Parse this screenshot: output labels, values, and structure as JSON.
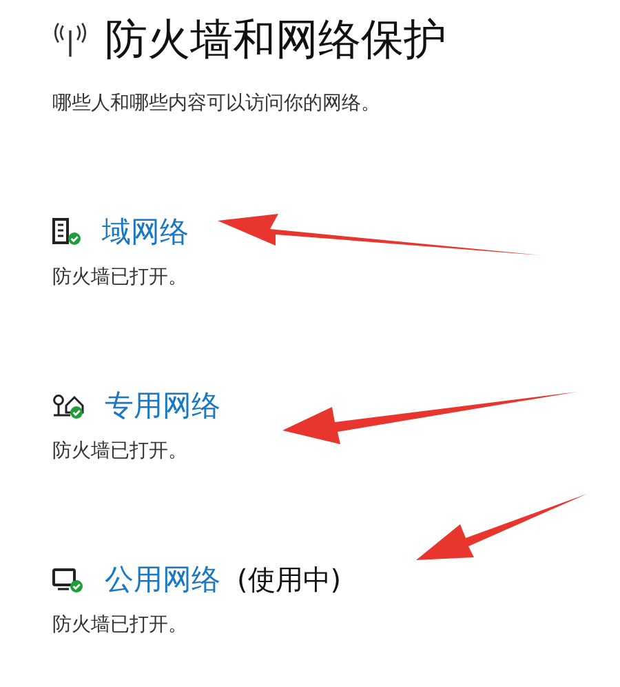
{
  "title": "防火墙和网络保护",
  "subtitle": "哪些人和哪些内容可以访问你的网络。",
  "networks": [
    {
      "kind": "domain",
      "name": "域网络",
      "status": "防火墙已打开。",
      "arrowed": true
    },
    {
      "kind": "private",
      "name": "专用网络",
      "status": "防火墙已打开。",
      "arrowed": true
    },
    {
      "kind": "public",
      "name": "公用网络",
      "in_use": "(使用中)",
      "status": "防火墙已打开。",
      "arrowed": true
    }
  ]
}
